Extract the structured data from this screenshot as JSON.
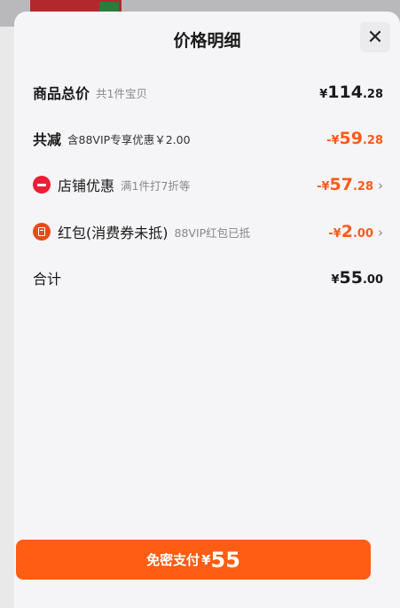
{
  "sheet": {
    "title": "价格明细",
    "close_glyph": "✕"
  },
  "rows": {
    "total": {
      "label": "商品总价",
      "note": "共1件宝贝",
      "currency": "¥",
      "int": "114",
      "dec": ".28"
    },
    "reduction": {
      "label": "共减",
      "note": "含88VIP专享优惠￥2.00",
      "currency": "-¥",
      "int": "59",
      "dec": ".28"
    },
    "shop_discount": {
      "icon": "shop-discount-icon",
      "label": "店铺优惠",
      "note": "满1件打7折等",
      "currency": "-¥",
      "int": "57",
      "dec": ".28"
    },
    "red_packet": {
      "icon": "red-packet-icon",
      "label": "红包(消费券未抵)",
      "note": "88VIP红包已抵",
      "currency": "-¥",
      "int": "2",
      "dec": ".00"
    },
    "sum": {
      "label": "合计",
      "currency": "¥",
      "int": "55",
      "dec": ".00"
    }
  },
  "pay_button": {
    "label": "免密支付",
    "currency": "¥",
    "amount": "55"
  },
  "colors": {
    "accent": "#ff5d14",
    "discount_text": "#ff5a1a",
    "shop_icon": "#ee1d35",
    "red_packet_icon": "#e64b1e"
  }
}
